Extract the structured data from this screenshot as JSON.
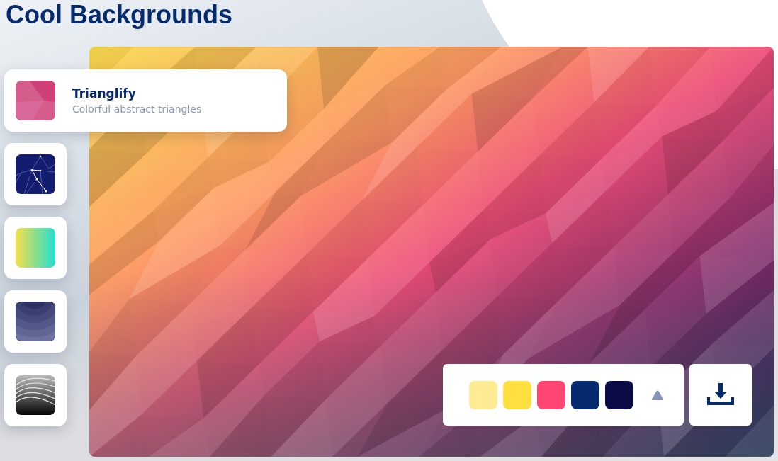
{
  "title": "Cool Backgrounds",
  "generators": [
    {
      "kind": "triangles",
      "name": "Trianglify",
      "description": "Colorful abstract triangles",
      "selected": true
    },
    {
      "kind": "network",
      "selected": false
    },
    {
      "kind": "gradient",
      "selected": false
    },
    {
      "kind": "rings",
      "selected": false
    },
    {
      "kind": "waves",
      "selected": false
    }
  ],
  "palette": [
    {
      "color": "#ffeb94"
    },
    {
      "color": "#ffe040"
    },
    {
      "color": "#ff4673"
    },
    {
      "color": "#062a6e"
    },
    {
      "color": "#0b0b46"
    }
  ]
}
